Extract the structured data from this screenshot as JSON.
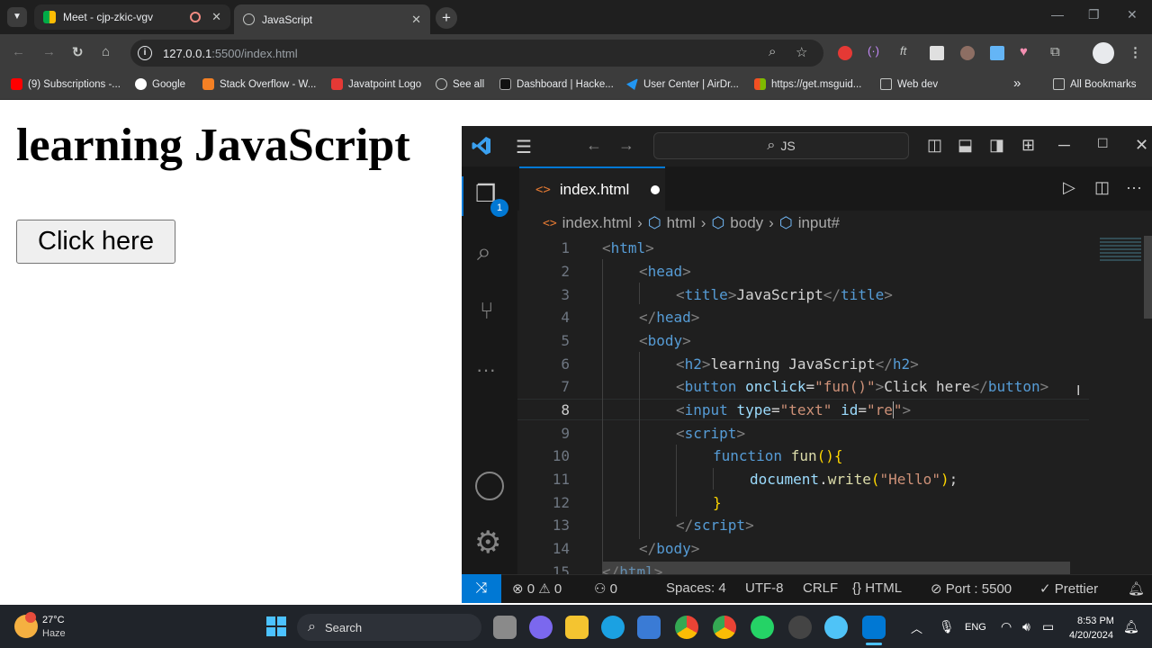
{
  "browser": {
    "tabs": [
      {
        "label": "Meet - cjp-zkic-vgv"
      },
      {
        "label": "JavaScript"
      }
    ],
    "url_host": "127.0.0.1",
    "url_path": ":5500/index.html",
    "bookmarks": [
      "(9) Subscriptions -...",
      "Google",
      "Stack Overflow - W...",
      "Javatpoint Logo",
      "See all",
      "Dashboard | Hacke...",
      "User Center | AirDr...",
      "https://get.msguid...",
      "Web dev"
    ],
    "all_bookmarks": "All Bookmarks"
  },
  "page": {
    "heading": "learning JavaScript",
    "button": "Click here"
  },
  "vscode": {
    "search": "JS",
    "tab_file": "index.html",
    "breadcrumb": [
      "index.html",
      "html",
      "body",
      "input#"
    ],
    "line_numbers": [
      "1",
      "2",
      "3",
      "4",
      "5",
      "6",
      "7",
      "8",
      "9",
      "10",
      "11",
      "12",
      "13",
      "14",
      "15"
    ],
    "explorer_badge": "1",
    "status": {
      "errors": "0",
      "warnings": "0",
      "ports": "0",
      "spaces": "Spaces: 4",
      "encoding": "UTF-8",
      "eol": "CRLF",
      "language": "HTML",
      "port": "Port : 5500",
      "prettier": "Prettier"
    }
  },
  "taskbar": {
    "temperature": "27°C",
    "weather": "Haze",
    "search": "Search",
    "lang": "ENG",
    "time": "8:53 PM",
    "date": "4/20/2024"
  }
}
